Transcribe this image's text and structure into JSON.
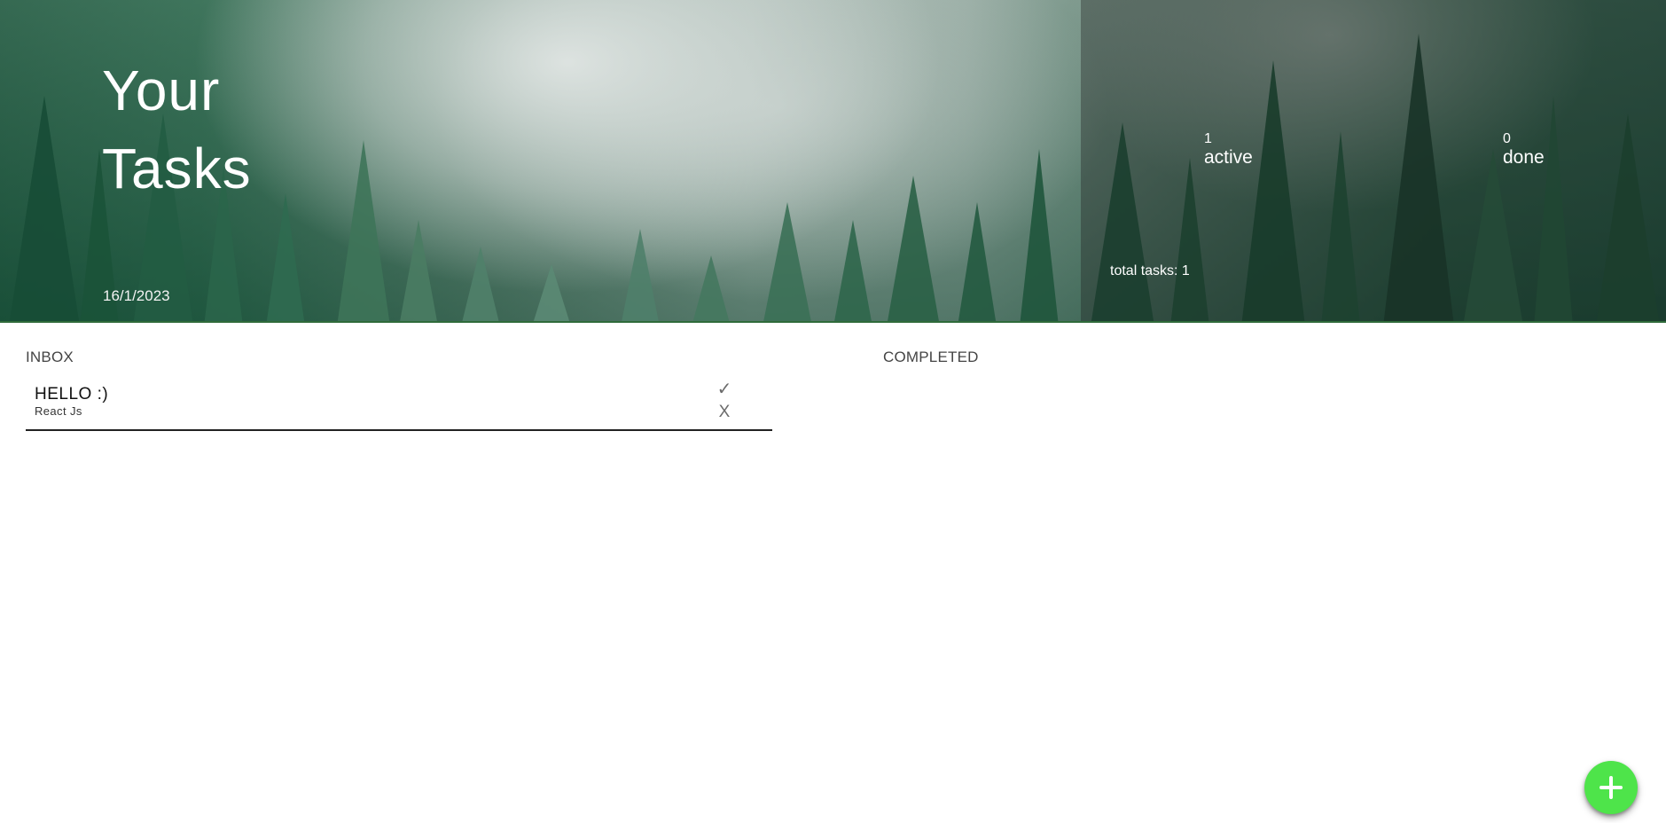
{
  "header": {
    "title": "Your Tasks",
    "date": "16/1/2023",
    "background": "misty pine forest"
  },
  "stats": {
    "active_count": "1",
    "active_label": "active",
    "done_count": "0",
    "done_label": "done",
    "total_tasks": "total tasks: 1"
  },
  "inbox": {
    "title": "INBOX",
    "tasks": [
      {
        "name": "HELLO :)",
        "subtitle": "React Js",
        "complete_icon": "✓",
        "delete_icon": "X"
      }
    ]
  },
  "completed": {
    "title": "COMPLETED",
    "tasks": []
  },
  "fab": {
    "icon": "plus-icon",
    "color": "#4ee44a"
  },
  "colors": {
    "accent": "#4ee44a",
    "hero_border": "#2f6b3a",
    "text_primary": "#111111",
    "text_muted": "#6b6b6b"
  }
}
